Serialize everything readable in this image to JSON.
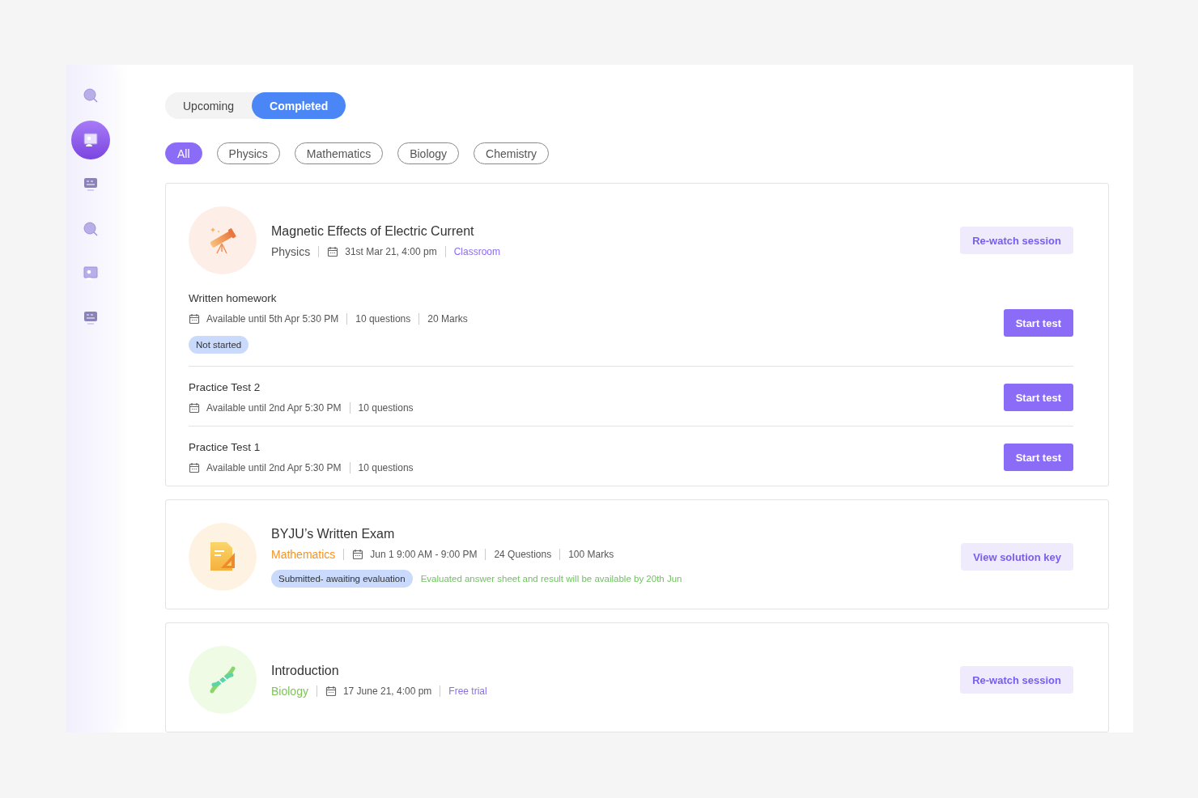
{
  "sidebar": {
    "items": [
      {
        "kind": "search",
        "selected": false
      },
      {
        "kind": "board",
        "selected": true
      },
      {
        "kind": "screen",
        "selected": false
      },
      {
        "kind": "search",
        "selected": false
      },
      {
        "kind": "board",
        "selected": false
      },
      {
        "kind": "screen",
        "selected": false
      }
    ]
  },
  "tabs": [
    {
      "label": "Upcoming",
      "selected": false
    },
    {
      "label": "Completed",
      "selected": true
    }
  ],
  "filters": [
    {
      "label": "All",
      "selected": true
    },
    {
      "label": "Physics",
      "selected": false
    },
    {
      "label": "Mathematics",
      "selected": false
    },
    {
      "label": "Biology",
      "selected": false
    },
    {
      "label": "Chemistry",
      "selected": false
    }
  ],
  "sessions": [
    {
      "kind": "telescope",
      "title": "Magnetic Effects of Electric Current",
      "subject": "Physics",
      "color": "#555555",
      "date": "31st Mar 21, 4:00 pm",
      "meta": [
        {
          "text": "Classroom",
          "kind": "link"
        }
      ],
      "action": "Re-watch session",
      "tests": [
        {
          "title": "Written homework",
          "available": "Available until 5th Apr 5:30 PM",
          "meta": [
            "10 questions",
            "20 Marks"
          ],
          "status": "Not started",
          "button": "Start test"
        },
        {
          "title": "Practice Test 2",
          "available": "Available until 2nd Apr 5:30 PM",
          "meta": [
            "10 questions"
          ],
          "button": "Start test"
        },
        {
          "title": "Practice Test 1",
          "available": "Available until 2nd Apr 5:30 PM",
          "meta": [
            "10 questions"
          ],
          "button": "Start test"
        }
      ]
    },
    {
      "kind": "document",
      "title": "BYJU’s Written Exam",
      "subject": "Mathematics",
      "color": "#f7931e",
      "date": "Jun 1 9:00 AM - 9:00 PM",
      "meta": [
        {
          "text": "24 Questions",
          "kind": "plain"
        },
        {
          "text": "100 Marks",
          "kind": "plain"
        }
      ],
      "status": "Submitted- awaiting evaluation",
      "note": "Evaluated answer sheet and result will be available by 20th Jun",
      "action": "View solution key"
    },
    {
      "kind": "dna",
      "title": "Introduction",
      "subject": "Biology",
      "color": "#7dc557",
      "date": "17 June 21, 4:00 pm",
      "meta": [
        {
          "text": "Free trial",
          "kind": "link"
        }
      ],
      "action": "Re-watch session"
    }
  ]
}
